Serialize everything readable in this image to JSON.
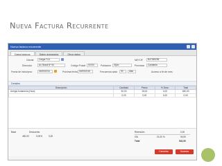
{
  "slide": {
    "title": "Nueva Factura Recurrente"
  },
  "window": {
    "title": "Nueva factura recurrente",
    "tabs": [
      "Datos básicos",
      "Datos avanzados",
      "Otros datos"
    ]
  },
  "form": {
    "cliente_label": "Cliente",
    "cliente_value": "Cargar S.A.",
    "direccion_label": "Dirección",
    "direccion_value": "Av. Brasil Nº 54",
    "cp_label": "Código Postal",
    "cp_value": "00700",
    "poblacion_label": "Población",
    "poblacion_value": "Gijón",
    "provincia_label": "Provincia",
    "provincia_value": "Cantabria",
    "nif_label": "NIF/CIF",
    "nif_value": "B47389296",
    "fecha_label": "Fecha de inicio/proc",
    "fecha_value": "04/05/2014",
    "proxima_label": "Próxima fecha",
    "proxima_value": "04/05/2015",
    "frecuencia_label": "Frecuencia cada",
    "frecuencia_value": "30",
    "frecuencia_unit": "días",
    "factura_label": "Acceso a fin de mes"
  },
  "lines": {
    "section_label": "Detalles",
    "columns": [
      "Descripción",
      "Cantidad",
      "Precio",
      "% Desc.",
      "Total"
    ],
    "rows": [
      {
        "desc": "Arreglo fontanería (Hora)",
        "qty": "30,00",
        "price": "15,00",
        "disc": "0,00",
        "total": "450,00"
      },
      {
        "desc": "",
        "qty": "0,00",
        "price": "0,00",
        "disc": "0,00",
        "total": "0,00"
      }
    ]
  },
  "totals": {
    "base_label": "Base",
    "base_value": "450,00",
    "discount_label": "Descuento",
    "discount_value": "0,00%",
    "discount_amount": "0,00",
    "tax_label": "IVA",
    "tax_rate": "21,00 %",
    "tax_amount": "94,50",
    "total_label": "Total",
    "total_value": "544,50",
    "retention_label": "Retención",
    "retention_value": "0,00"
  },
  "buttons": {
    "cancel": "Cancelar",
    "save": "Guardar"
  },
  "colors": {
    "titlebar": "#2f5fb3",
    "accent": "#d83a2a",
    "slide_accent": "#a9c26a"
  }
}
